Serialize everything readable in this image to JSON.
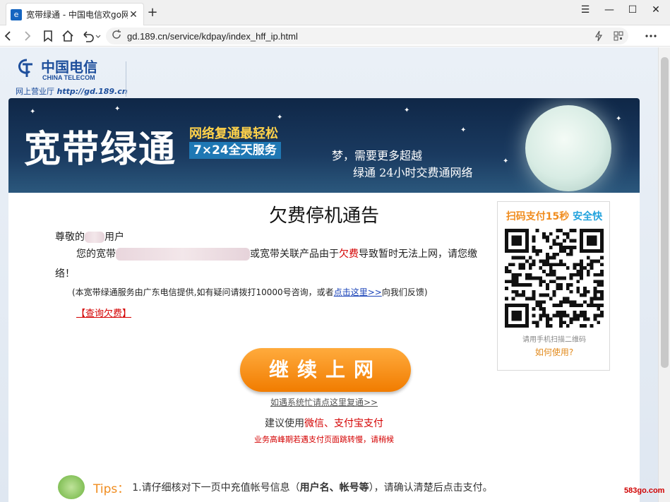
{
  "browser": {
    "tab_title": "宽带绿通 - 中国电信欢go网",
    "tab_close": "✕",
    "new_tab": "+",
    "url": "gd.189.cn/service/kdpay/index_hff_ip.html",
    "window_controls": [
      "☰",
      "—",
      "☐",
      "✕"
    ],
    "icons": [
      "back-icon",
      "forward-icon",
      "bookmark-icon",
      "home-icon",
      "undo-icon",
      "reload-icon",
      "lightning-icon",
      "qr-scan-icon",
      "more-icon"
    ]
  },
  "logo": {
    "cn": "中国电信",
    "en": "CHINA TELECOM",
    "sub": "网上营业厅",
    "url": "http://gd.189.cn"
  },
  "banner": {
    "title": "宽带绿通",
    "sub1": "网络复通最轻松",
    "sub2": "7×24全天服务",
    "quote1": "梦，需要更多超越",
    "quote2": "绿通 24小时交费通网络"
  },
  "notice": {
    "title": "欠费停机通告",
    "greet_prefix": "尊敬的",
    "greet_suffix": "用户",
    "line1_prefix": "您的宽带",
    "line1_mid": "或宽带关联产品由于",
    "line1_red": "欠费",
    "line1_suffix": "导致暂时无法上网，请您缴",
    "line2": "络！",
    "info_prefix": "(本宽带绿通服务由广东电信提供,如有疑问请拨打10000号咨询，或者",
    "info_link": "点击这里>>",
    "info_suffix": "向我们反馈)",
    "query": "【查询欠费】"
  },
  "qr": {
    "head_orange": "扫码支付15秒",
    "head_blue": "安全快",
    "caption": "请用手机扫描二维码",
    "how": "如何使用?"
  },
  "actions": {
    "continue": "继续上网",
    "retry": "如遇系统忙请点这里复通>>",
    "pay_prefix": "建议使用",
    "pay_red": "微信、支付宝支付",
    "peak": "业务高峰期若遇支付页面跳转慢，请稍候"
  },
  "tips": {
    "label": "Tips：",
    "text_prefix": "1.请仔细核对下一页中充值帐号信息（",
    "text_bold": "用户名、帐号等",
    "text_suffix": "），请确认清楚后点击支付。"
  },
  "watermark": "583go.com",
  "colors": {
    "accent_orange": "#f17c00",
    "red": "#d40000",
    "link": "#1a43b8",
    "banner": "#0f2747"
  }
}
